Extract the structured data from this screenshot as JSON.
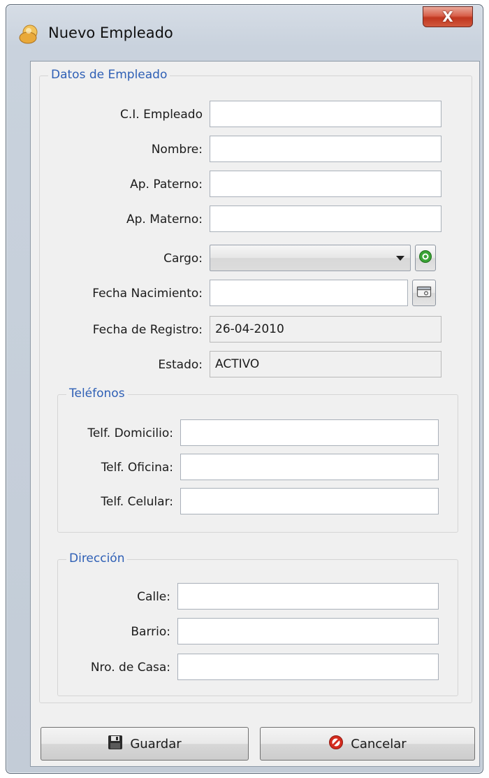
{
  "window": {
    "title": "Nuevo Empleado",
    "close_label": "X"
  },
  "groups": {
    "employee": {
      "legend": "Datos de Empleado"
    },
    "phones": {
      "legend": "Teléfonos"
    },
    "address": {
      "legend": "Dirección"
    }
  },
  "fields": {
    "ci": {
      "label": "C.I. Empleado",
      "value": ""
    },
    "nombre": {
      "label": "Nombre:",
      "value": ""
    },
    "ap_paterno": {
      "label": "Ap. Paterno:",
      "value": ""
    },
    "ap_materno": {
      "label": "Ap. Materno:",
      "value": ""
    },
    "cargo": {
      "label": "Cargo:",
      "value": ""
    },
    "fecha_nacimiento": {
      "label": "Fecha Nacimiento:",
      "value": ""
    },
    "fecha_registro": {
      "label": "Fecha de Registro:",
      "value": "26-04-2010"
    },
    "estado": {
      "label": "Estado:",
      "value": "ACTIVO"
    },
    "telf_domicilio": {
      "label": "Telf. Domicilio:",
      "value": ""
    },
    "telf_oficina": {
      "label": "Telf. Oficina:",
      "value": ""
    },
    "telf_celular": {
      "label": "Telf. Celular:",
      "value": ""
    },
    "calle": {
      "label": "Calle:",
      "value": ""
    },
    "barrio": {
      "label": "Barrio:",
      "value": ""
    },
    "nro_casa": {
      "label": "Nro. de Casa:",
      "value": ""
    }
  },
  "buttons": {
    "guardar": "Guardar",
    "cancelar": "Cancelar"
  },
  "icons": {
    "app": "employee-icon",
    "add": "plus-circle-icon",
    "calendar": "calendar-icon",
    "save": "floppy-disk-icon",
    "cancel": "no-entry-icon"
  },
  "colors": {
    "legend": "#2e5fb5",
    "close": "#c0361f",
    "add_icon": "#3aa335",
    "cancel_icon": "#d42b1e"
  }
}
